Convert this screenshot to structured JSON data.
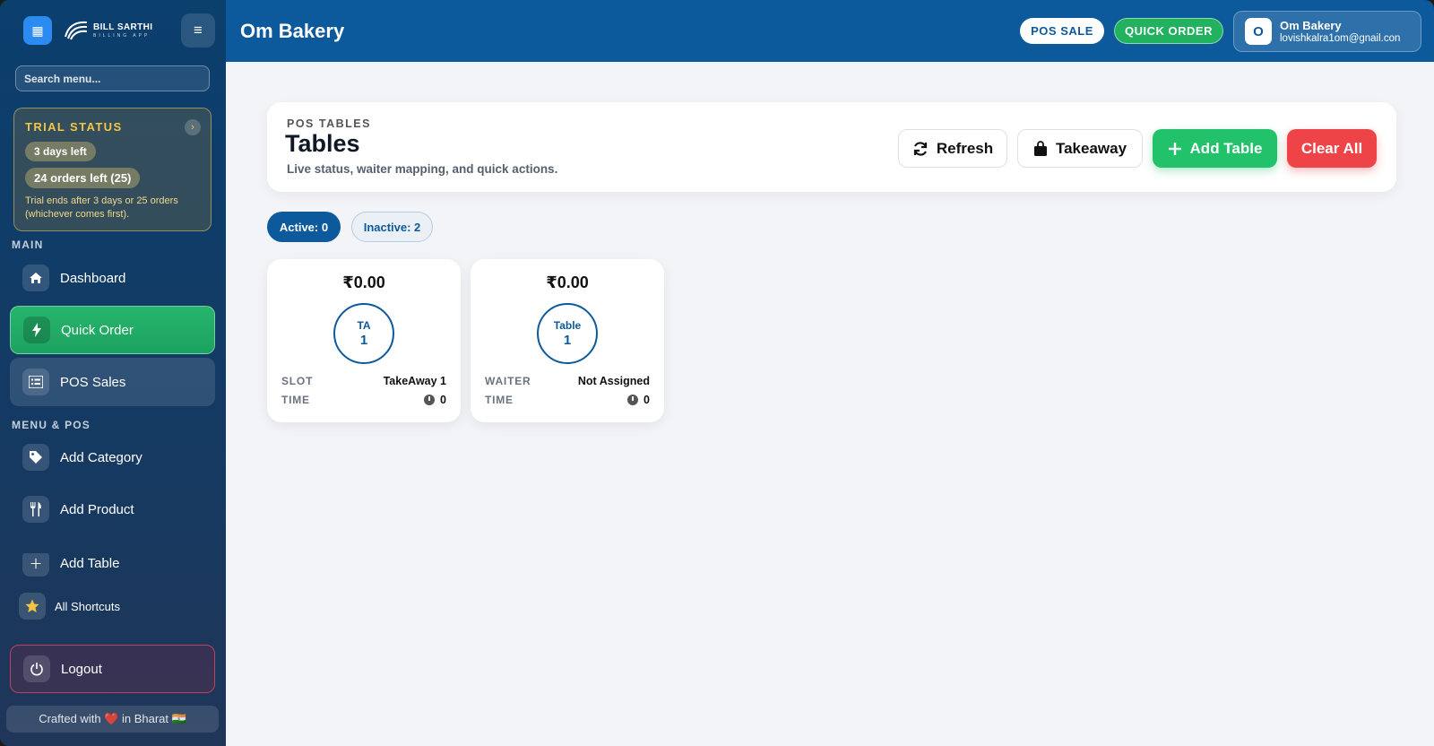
{
  "brand": {
    "name": "BILL SARTHI",
    "subtitle": "BILLING APP"
  },
  "sidebar": {
    "search_placeholder": "Search menu...",
    "trial": {
      "title": "TRIAL STATUS",
      "days_left": "3 days left",
      "orders_left": "24 orders left (25)",
      "note": "Trial ends after 3 days or 25 orders (whichever comes first)."
    },
    "sections": {
      "main": "MAIN",
      "menu_pos": "MENU & POS"
    },
    "items": [
      {
        "label": "Dashboard",
        "icon": "home-icon"
      },
      {
        "label": "Quick Order",
        "icon": "bolt-icon"
      },
      {
        "label": "POS Sales",
        "icon": "list-icon"
      },
      {
        "label": "Add Category",
        "icon": "tag-icon"
      },
      {
        "label": "Add Product",
        "icon": "utensils-icon"
      },
      {
        "label": "Add Table",
        "icon": "plus-icon"
      }
    ],
    "shortcuts_label": "All Shortcuts",
    "logout_label": "Logout",
    "footer": "Crafted with ❤️ in Bharat 🇮🇳"
  },
  "header": {
    "title": "Om Bakery",
    "pos_sale": "POS SALE",
    "quick_order": "QUICK ORDER",
    "user": {
      "initial": "O",
      "name": "Om Bakery",
      "email": "lovishkalra1om@gnail.con"
    }
  },
  "panel": {
    "eyebrow": "POS TABLES",
    "title": "Tables",
    "description": "Live status, waiter mapping, and quick actions.",
    "refresh": "Refresh",
    "takeaway": "Takeaway",
    "add_table": "Add Table",
    "clear_all": "Clear All"
  },
  "filters": {
    "active": "Active: 0",
    "inactive": "Inactive: 2"
  },
  "tables": [
    {
      "amount": "₹0.00",
      "circle_label": "TA",
      "circle_num": "1",
      "row1_key": "SLOT",
      "row1_val": "TakeAway 1",
      "row2_key": "TIME",
      "row2_val": "0"
    },
    {
      "amount": "₹0.00",
      "circle_label": "Table",
      "circle_num": "1",
      "row1_key": "WAITER",
      "row1_val": "Not Assigned",
      "row2_key": "TIME",
      "row2_val": "0"
    }
  ],
  "colors": {
    "primary": "#0c5a9c",
    "success": "#22c26a",
    "danger": "#ef4447",
    "trial_gold": "#f4c542"
  }
}
